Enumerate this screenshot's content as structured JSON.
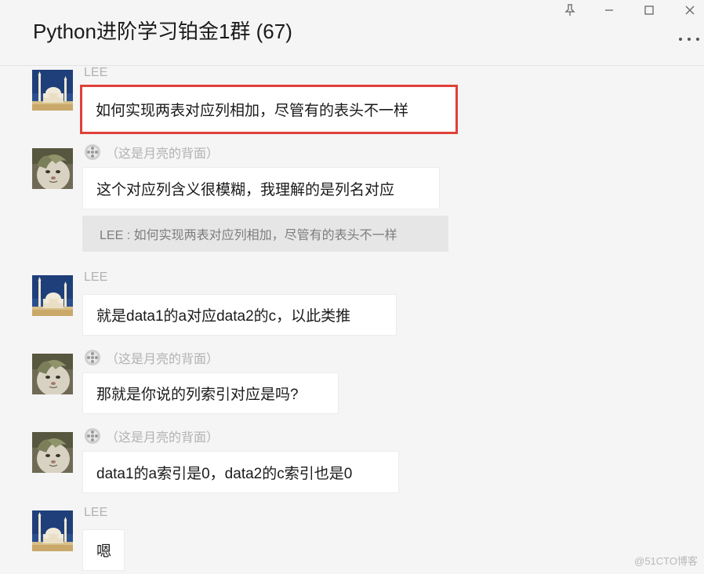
{
  "window": {
    "title": "Python进阶学习铂金1群 (67)",
    "controls": [
      "pin-icon",
      "minimize-icon",
      "maximize-icon",
      "close-icon"
    ],
    "more_icon": "more-dots-icon"
  },
  "messages": [
    {
      "sender": "LEE",
      "text": "如何实现两表对应列相加，尽管有的表头不一样",
      "highlighted": true,
      "avatar": "mosque-avatar"
    },
    {
      "sender": "（这是月亮的背面）",
      "text": "这个对应列含义很模糊，我理解的是列名对应",
      "avatar": "cat-avatar",
      "quote": "LEE : 如何实现两表对应列相加，尽管有的表头不一样"
    },
    {
      "sender": "LEE",
      "text": "就是data1的a对应data2的c，以此类推",
      "avatar": "mosque-avatar"
    },
    {
      "sender": "（这是月亮的背面）",
      "text": "那就是你说的列索引对应是吗?",
      "avatar": "cat-avatar"
    },
    {
      "sender": "（这是月亮的背面）",
      "text": "data1的a索引是0，data2的c索引也是0",
      "avatar": "cat-avatar"
    },
    {
      "sender": "LEE",
      "text": "嗯",
      "avatar": "mosque-avatar"
    }
  ],
  "watermark": "@51CTO博客",
  "colors": {
    "highlight": "#e0403a",
    "background": "#f5f5f5",
    "bubble": "#ffffff",
    "quote_bg": "#e6e6e6"
  }
}
